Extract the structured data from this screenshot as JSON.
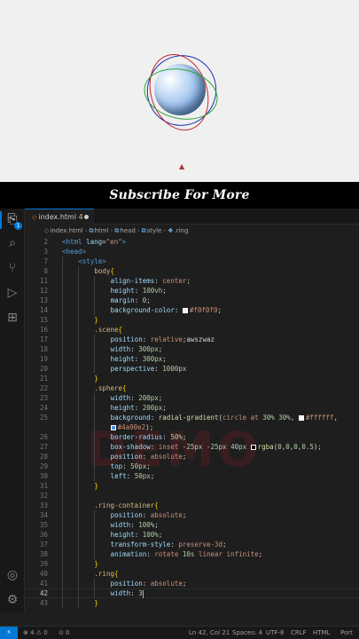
{
  "banner": {
    "text": "Subscribe For More"
  },
  "tab": {
    "filename": "index.html",
    "modified_count": "4"
  },
  "breadcrumb": {
    "items": [
      "index.html",
      "html",
      "head",
      "style",
      ".ring"
    ]
  },
  "activity": {
    "explorer_badge": "1"
  },
  "code_lines": [
    {
      "n": "2",
      "indent": 0,
      "html": "<span class='t-tag'>&lt;html</span> <span class='t-attr'>lang</span><span class='t-punct'>=</span><span class='t-str'>\"en\"</span><span class='t-tag'>&gt;</span>"
    },
    {
      "n": "3",
      "indent": 0,
      "html": "<span class='t-tag'>&lt;head&gt;</span>"
    },
    {
      "n": "7",
      "indent": 1,
      "html": "<span class='t-tag'>&lt;style&gt;</span>"
    },
    {
      "n": "8",
      "indent": 2,
      "html": "<span class='t-sel'>body</span><span class='t-brace'>{</span>"
    },
    {
      "n": "11",
      "indent": 3,
      "html": "<span class='t-prop'>align-items</span>: <span class='t-val'>center</span>;"
    },
    {
      "n": "12",
      "indent": 3,
      "html": "<span class='t-prop'>height</span>: <span class='t-num'>100vh</span>;"
    },
    {
      "n": "13",
      "indent": 3,
      "html": "<span class='t-prop'>margin</span>: <span class='t-num'>0</span>;"
    },
    {
      "n": "14",
      "indent": 3,
      "html": "<span class='t-prop'>background-color</span>: <span class='swatch' style='background:#f0f0f0'></span><span class='t-val'>#f0f0f0</span>;"
    },
    {
      "n": "15",
      "indent": 2,
      "html": "<span class='t-brace'>}</span>"
    },
    {
      "n": "16",
      "indent": 2,
      "html": "<span class='t-sel'>.scene</span><span class='t-brace'>{</span>"
    },
    {
      "n": "17",
      "indent": 3,
      "html": "<span class='t-prop'>position</span>: <span class='t-val'>relative</span>;awszwaz"
    },
    {
      "n": "18",
      "indent": 3,
      "html": "<span class='t-prop'>width</span>: <span class='t-num'>300px</span>;"
    },
    {
      "n": "19",
      "indent": 3,
      "html": "<span class='t-prop'>height</span>: <span class='t-num'>300px</span>;"
    },
    {
      "n": "20",
      "indent": 3,
      "html": "<span class='t-prop'>perspective</span>: <span class='t-num'>1000px</span>"
    },
    {
      "n": "21",
      "indent": 2,
      "html": "<span class='t-brace'>}</span>"
    },
    {
      "n": "22",
      "indent": 2,
      "html": "<span class='t-sel'>.sphere</span><span class='t-brace'>{</span>"
    },
    {
      "n": "23",
      "indent": 3,
      "html": "<span class='t-prop'>width</span>: <span class='t-num'>200px</span>;"
    },
    {
      "n": "24",
      "indent": 3,
      "html": "<span class='t-prop'>height</span>: <span class='t-num'>200px</span>;"
    },
    {
      "n": "25",
      "indent": 3,
      "html": "<span class='t-prop'>background</span>: <span class='t-fn'>radial-gradient</span>(<span class='t-val'>circle at</span> <span class='t-num'>30%</span> <span class='t-num'>30%</span>, <span class='swatch' style='background:#ffffff'></span><span class='t-val'>#ffffff</span>,"
    },
    {
      "n": "",
      "indent": 3,
      "html": "<span class='swatch' style='background:#4a90e2'></span><span class='t-val'>#4a90e2</span>);"
    },
    {
      "n": "26",
      "indent": 3,
      "html": "<span class='t-prop'>border-radius</span>: <span class='t-num'>50%</span>;"
    },
    {
      "n": "27",
      "indent": 3,
      "html": "<span class='t-prop'>box-shadow</span>: <span class='t-val'>inset</span> <span class='t-num'>-25px</span> <span class='t-num'>-25px</span> <span class='t-num'>40px</span> <span class='swatch' style='background:#000'></span><span class='t-fn'>rgba</span>(<span class='t-num'>0</span>,<span class='t-num'>0</span>,<span class='t-num'>0</span>,<span class='t-num'>0.5</span>);"
    },
    {
      "n": "28",
      "indent": 3,
      "html": "<span class='t-prop'>position</span>: <span class='t-val'>absolute</span>;"
    },
    {
      "n": "29",
      "indent": 3,
      "html": "<span class='t-prop'>top</span>: <span class='t-num'>50px</span>;"
    },
    {
      "n": "30",
      "indent": 3,
      "html": "<span class='t-prop'>left</span>: <span class='t-num'>50px</span>;"
    },
    {
      "n": "31",
      "indent": 2,
      "html": "<span class='t-brace'>}</span>"
    },
    {
      "n": "32",
      "indent": 2,
      "html": ""
    },
    {
      "n": "33",
      "indent": 2,
      "html": "<span class='t-sel'>.ring-container</span><span class='t-brace'>{</span>"
    },
    {
      "n": "34",
      "indent": 3,
      "html": "<span class='t-prop'>position</span>: <span class='t-val'>absolute</span>;"
    },
    {
      "n": "35",
      "indent": 3,
      "html": "<span class='t-prop'>width</span>: <span class='t-num'>100%</span>;"
    },
    {
      "n": "36",
      "indent": 3,
      "html": "<span class='t-prop'>height</span>: <span class='t-num'>100%</span>;"
    },
    {
      "n": "37",
      "indent": 3,
      "html": "<span class='t-prop'>transform-style</span>: <span class='t-val'>preserve-3d</span>;"
    },
    {
      "n": "38",
      "indent": 3,
      "html": "<span class='t-prop'>animation</span>: <span class='t-val'>rotate</span> <span class='t-num'>10s</span> <span class='t-val'>linear infinite</span>;"
    },
    {
      "n": "39",
      "indent": 2,
      "html": "<span class='t-brace'>}</span>"
    },
    {
      "n": "40",
      "indent": 2,
      "html": "<span class='t-sel'>.ring</span><span class='t-brace'>{</span>"
    },
    {
      "n": "41",
      "indent": 3,
      "html": "<span class='t-prop'>position</span>: <span class='t-val'>absolute</span>;"
    },
    {
      "n": "42",
      "indent": 3,
      "html": "<span class='t-prop'>width</span>: <span class='t-num'>3</span><span class='caret'></span>",
      "current": true
    },
    {
      "n": "43",
      "indent": 2,
      "html": "<span class='t-brace'>}</span>"
    }
  ],
  "watermark": {
    "text": "DEMO"
  },
  "status": {
    "errors": "4",
    "warnings": "0",
    "info": "0",
    "position": "Ln 42, Col 21",
    "spaces": "Spaces: 4",
    "encoding": "UTF-8",
    "eol": "CRLF",
    "language": "HTML",
    "port": "Port"
  },
  "colors": {
    "editor_bg": "#1e1e1e",
    "accent": "#0078d4",
    "sphere_light": "#ffffff",
    "sphere_dark": "#4a90e2",
    "ring_red": "#c0282b",
    "ring_green": "#2aa33c",
    "ring_blue": "#1d2fb0"
  }
}
